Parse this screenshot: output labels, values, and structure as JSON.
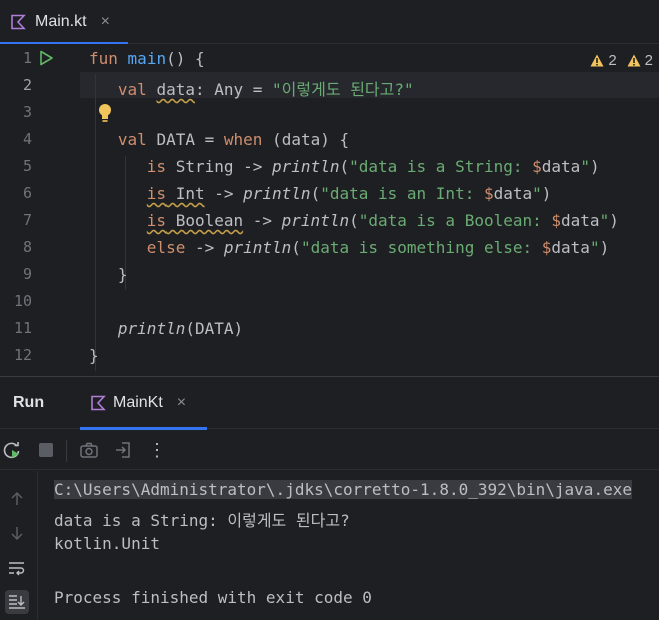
{
  "editor_tab": {
    "label": "Main.kt",
    "close": "×",
    "icon": "kotlin-file-icon"
  },
  "warnings": {
    "count_a": "2",
    "count_b": "2"
  },
  "code": {
    "line_numbers": [
      "1",
      "2",
      "3",
      "4",
      "5",
      "6",
      "7",
      "8",
      "9",
      "10",
      "11",
      "12"
    ],
    "l1_fun": "fun",
    "l1_name": "main",
    "l1_rest": "() {",
    "l2_val": "val",
    "l2_var": "data",
    "l2_type": ": Any = ",
    "l2_str": "\"이렇게도 된다고?\"",
    "l4_val": "val",
    "l4_var": "DATA",
    "l4_eq": " = ",
    "l4_when": "when",
    "l4_rest": " (data) {",
    "l5_is": "is",
    "l5_type": " String -> ",
    "l5_fn": "println",
    "l5_p1": "(",
    "l5_str": "\"data is a String: ",
    "l5_tmpl": "$",
    "l5_strvar": "data",
    "l5_strend": "\"",
    "l5_p2": ")",
    "l6_is": "is",
    "l6_type": " Int",
    "l6_arrow": " -> ",
    "l6_fn": "println",
    "l6_p1": "(",
    "l6_str": "\"data is an Int: ",
    "l6_tmpl": "$",
    "l6_strvar": "data",
    "l6_strend": "\"",
    "l6_p2": ")",
    "l7_is": "is",
    "l7_type": " Boolean",
    "l7_arrow": " -> ",
    "l7_fn": "println",
    "l7_p1": "(",
    "l7_str": "\"data is a Boolean: ",
    "l7_tmpl": "$",
    "l7_strvar": "data",
    "l7_strend": "\"",
    "l7_p2": ")",
    "l8_else": "else",
    "l8_arrow": " -> ",
    "l8_fn": "println",
    "l8_p1": "(",
    "l8_str": "\"data is something else: ",
    "l8_tmpl": "$",
    "l8_strvar": "data",
    "l8_strend": "\"",
    "l8_p2": ")",
    "l9": "}",
    "l11_fn": "println",
    "l11_rest": "(DATA)",
    "l12": "}"
  },
  "run_panel": {
    "title": "Run",
    "tab_label": "MainKt",
    "tab_close": "×",
    "more": "⋮"
  },
  "console": {
    "line1": "C:\\Users\\Administrator\\.jdks\\corretto-1.8.0_392\\bin\\java.exe",
    "line2": "data is a String: 이렇게도 된다고?",
    "line3": "kotlin.Unit",
    "line4": "Process finished with exit code 0"
  },
  "colors": {
    "background": "#1e1f22",
    "keyword": "#cf8e6d",
    "function": "#56a8f5",
    "string": "#6aab73",
    "accent": "#3574f0",
    "warning": "#f2c55c"
  }
}
